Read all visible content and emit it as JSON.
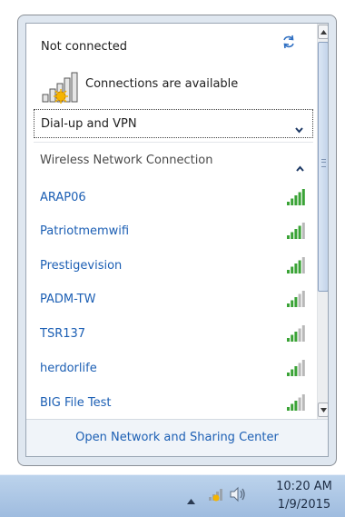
{
  "panel": {
    "status": "Not connected",
    "availability": "Connections are available",
    "dialup_label": "Dial-up and VPN",
    "wireless_label": "Wireless Network Connection",
    "networks": [
      {
        "name": "ARAP06",
        "signal": 5
      },
      {
        "name": "Patriotmemwifi",
        "signal": 4
      },
      {
        "name": "Prestigevision",
        "signal": 4
      },
      {
        "name": "PADM-TW",
        "signal": 3
      },
      {
        "name": "TSR137",
        "signal": 3
      },
      {
        "name": "herdorlife",
        "signal": 3
      },
      {
        "name": "BIG File Test",
        "signal": 3
      }
    ],
    "footer_link": "Open Network and Sharing Center"
  },
  "taskbar": {
    "time": "10:20 AM",
    "date": "1/9/2015"
  },
  "icons": [
    "refresh-icon",
    "network-available-icon",
    "chevron-down-icon",
    "chevron-up-icon",
    "signal-icon",
    "show-hidden-icons",
    "network-tray-icon",
    "volume-icon"
  ],
  "colors": {
    "link": "#1c5fb4",
    "signal_active": "#3aa336",
    "signal_inactive": "#b8b8b8"
  }
}
